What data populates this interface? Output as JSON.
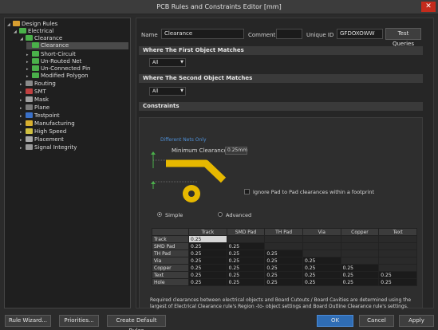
{
  "window": {
    "title": "PCB Rules and Constraints Editor [mm]",
    "close_glyph": "✕"
  },
  "tree": {
    "items": [
      {
        "label": "Design Rules",
        "twisty": "◢",
        "color": "#d8a030"
      },
      {
        "label": "Electrical",
        "twisty": "◢",
        "color": "#4ab04a"
      },
      {
        "label": "Clearance",
        "twisty": "◢",
        "color": "#4ab04a"
      },
      {
        "label": "Clearance",
        "twisty": "",
        "color": "#4ab04a"
      },
      {
        "label": "Short-Circuit",
        "twisty": "▸",
        "color": "#4ab04a"
      },
      {
        "label": "Un-Routed Net",
        "twisty": "▸",
        "color": "#4ab04a"
      },
      {
        "label": "Un-Connected Pin",
        "twisty": "▸",
        "color": "#4ab04a"
      },
      {
        "label": "Modified Polygon",
        "twisty": "▸",
        "color": "#4ab04a"
      },
      {
        "label": "Routing",
        "twisty": "▸",
        "color": "#8a8a8a"
      },
      {
        "label": "SMT",
        "twisty": "▸",
        "color": "#c04040"
      },
      {
        "label": "Mask",
        "twisty": "▸",
        "color": "#a0a0a0"
      },
      {
        "label": "Plane",
        "twisty": "▸",
        "color": "#7a7a7a"
      },
      {
        "label": "Testpoint",
        "twisty": "▸",
        "color": "#3a70c8"
      },
      {
        "label": "Manufacturing",
        "twisty": "▸",
        "color": "#d8b030"
      },
      {
        "label": "High Speed",
        "twisty": "▸",
        "color": "#d0c040"
      },
      {
        "label": "Placement",
        "twisty": "▸",
        "color": "#a8a8a8"
      },
      {
        "label": "Signal Integrity",
        "twisty": "▸",
        "color": "#9a9a9a"
      }
    ]
  },
  "header": {
    "name_label": "Name",
    "name_value": "Clearance",
    "comment_label": "Comment",
    "comment_value": "",
    "uid_label": "Unique ID",
    "uid_value": "GFDOXOWW",
    "test_queries": "Test Queries"
  },
  "first_match": {
    "title": "Where The First Object Matches",
    "value": "All"
  },
  "second_match": {
    "title": "Where The Second Object Matches",
    "value": "All"
  },
  "constraints": {
    "title": "Constraints",
    "diagram_title": "Different Nets Only",
    "min_clearance_label": "Minimum Clearance",
    "min_clearance_value": "0.25mm",
    "ignore_pad_label": "Ignore Pad to Pad clearances within a footprint",
    "ignore_pad_checked": false,
    "mode_simple": "Simple",
    "mode_advanced": "Advanced",
    "selected_mode": "Simple",
    "table": {
      "columns": [
        "",
        "Track",
        "SMD Pad",
        "TH Pad",
        "Via",
        "Copper",
        "Text"
      ],
      "rows": [
        {
          "name": "Track",
          "values": [
            "0.25",
            "",
            "",
            "",
            "",
            ""
          ]
        },
        {
          "name": "SMD Pad",
          "values": [
            "0.25",
            "0.25",
            "",
            "",
            "",
            ""
          ]
        },
        {
          "name": "TH Pad",
          "values": [
            "0.25",
            "0.25",
            "0.25",
            "",
            "",
            ""
          ]
        },
        {
          "name": "Via",
          "values": [
            "0.25",
            "0.25",
            "0.25",
            "0.25",
            "",
            ""
          ]
        },
        {
          "name": "Copper",
          "values": [
            "0.25",
            "0.25",
            "0.25",
            "0.25",
            "0.25",
            ""
          ]
        },
        {
          "name": "Text",
          "values": [
            "0.25",
            "0.25",
            "0.25",
            "0.25",
            "0.25",
            "0.25"
          ]
        },
        {
          "name": "Hole",
          "values": [
            "0.25",
            "0.25",
            "0.25",
            "0.25",
            "0.25",
            "0.25"
          ]
        }
      ]
    },
    "note": "Required clearances between electrical objects and Board Cutouts / Board Cavities are determined using the largest of Electrical Clearance rule's Region -to- object settings and Board Outline Clearance rule's settings."
  },
  "footer": {
    "rule_wizard": "Rule Wizard...",
    "priorities": "Priorities...",
    "create_defaults": "Create Default Rules",
    "ok": "OK",
    "cancel": "Cancel",
    "apply": "Apply"
  },
  "colors": {
    "accent_blue": "#4e8fd6",
    "trace_yellow": "#e6b800",
    "ok_blue": "#2f6db5"
  }
}
